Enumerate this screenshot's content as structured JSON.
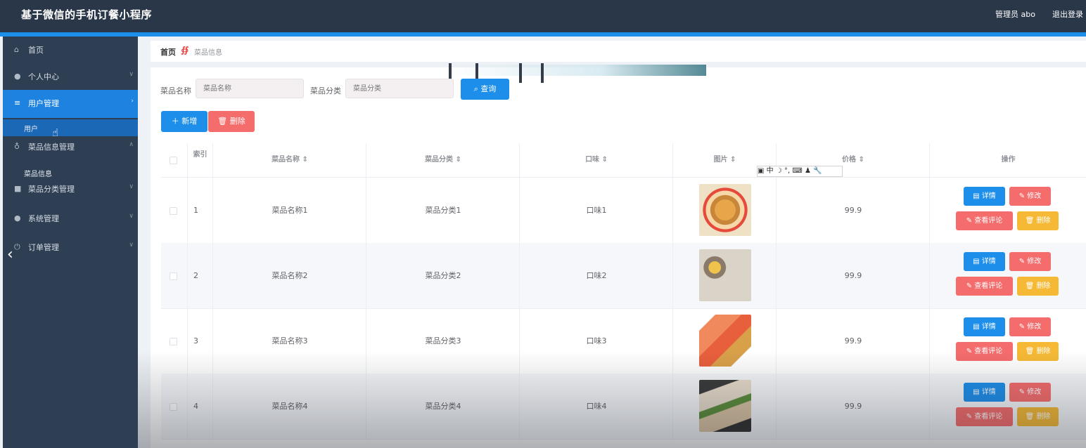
{
  "app": {
    "title": "基于微信的手机订餐小程序",
    "user": "管理员 abo",
    "logout": "退出登录"
  },
  "sidebar": {
    "items": [
      {
        "label": "首页",
        "icon": "home-icon"
      },
      {
        "label": "个人中心",
        "icon": "user-icon"
      },
      {
        "label": "用户管理",
        "icon": "menu-icon"
      },
      {
        "label": "菜品信息管理",
        "icon": "mic-icon"
      },
      {
        "label": "菜品分类管理",
        "icon": "category-icon"
      },
      {
        "label": "系统管理",
        "icon": "user-icon"
      },
      {
        "label": "订单管理",
        "icon": "power-icon"
      }
    ],
    "sub_users": "用户",
    "sub_dishes": "菜品信息"
  },
  "breadcrumb": {
    "home": "首页",
    "current": "菜品信息"
  },
  "filters": {
    "name_label": "菜品名称",
    "name_placeholder": "菜品名称",
    "category_label": "菜品分类",
    "category_placeholder": "菜品分类",
    "search_button": "查询"
  },
  "toolbar": {
    "add_button": "新增",
    "delete_button": "删除"
  },
  "table": {
    "columns": {
      "index": "索引",
      "name": "菜品名称",
      "category": "菜品分类",
      "taste": "口味",
      "image": "图片",
      "price": "价格",
      "actions": "操作"
    },
    "rows": [
      {
        "index": "1",
        "name": "菜品名称1",
        "category": "菜品分类1",
        "taste": "口味1",
        "price": "99.9"
      },
      {
        "index": "2",
        "name": "菜品名称2",
        "category": "菜品分类2",
        "taste": "口味2",
        "price": "99.9"
      },
      {
        "index": "3",
        "name": "菜品名称3",
        "category": "菜品分类3",
        "taste": "口味3",
        "price": "99.9"
      },
      {
        "index": "4",
        "name": "菜品名称4",
        "category": "菜品分类4",
        "taste": "口味4",
        "price": "99.9"
      }
    ],
    "actions": {
      "detail": "详情",
      "edit": "修改",
      "review": "查看评论",
      "delete": "删除"
    }
  },
  "ime": {
    "label": "中"
  },
  "colors": {
    "primary": "#1d8eea",
    "danger": "#f56c6c",
    "warning": "#f5b935",
    "sidebar": "#2e3f53",
    "header": "#2a3748"
  }
}
